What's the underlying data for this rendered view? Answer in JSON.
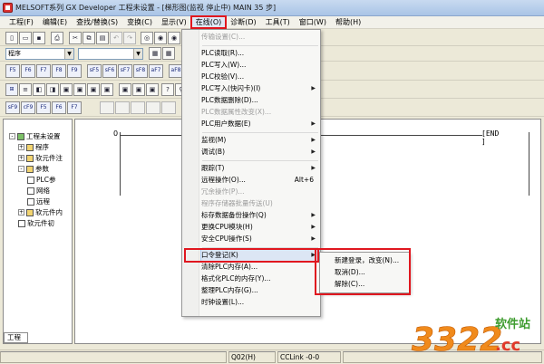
{
  "window": {
    "title": "MELSOFT系列 GX Developer 工程未设置 - [梯形图(监视 停止中)    MAIN    35 步]"
  },
  "menubar": {
    "items": [
      "工程(F)",
      "编辑(E)",
      "查找/替换(S)",
      "变换(C)",
      "显示(V)",
      "在线(O)",
      "诊断(D)",
      "工具(T)",
      "窗口(W)",
      "帮助(H)"
    ],
    "active_index": 5
  },
  "toolbar": {
    "combo1_value": "程序",
    "combo2_value": "",
    "ladder_buttons": [
      "F5",
      "F6",
      "F7",
      "F8",
      "F9",
      "sF5",
      "sF6",
      "sF7",
      "sF8",
      "aF7",
      "aF8",
      "F10",
      "aF9",
      "F11",
      "aF5"
    ],
    "row4_buttons": [
      "sF9",
      "cF9",
      "F5",
      "F6",
      "F7"
    ]
  },
  "tree": {
    "items": [
      {
        "label": "工程未设置",
        "level": 0,
        "icon": "project-icon",
        "expander": "-"
      },
      {
        "label": "程序",
        "level": 1,
        "icon": "folder-icon",
        "expander": "+"
      },
      {
        "label": "软元件注",
        "level": 1,
        "icon": "folder-icon",
        "expander": "+"
      },
      {
        "label": "参数",
        "level": 1,
        "icon": "folder-icon",
        "expander": "-"
      },
      {
        "label": "PLC参",
        "level": 2,
        "icon": "document-icon"
      },
      {
        "label": "网络",
        "level": 2,
        "icon": "document-icon"
      },
      {
        "label": "远程",
        "level": 2,
        "icon": "document-icon"
      },
      {
        "label": "软元件内",
        "level": 1,
        "icon": "folder-icon",
        "expander": "+"
      },
      {
        "label": "软元件初",
        "level": 1,
        "icon": "document-icon"
      }
    ],
    "tab_label": "工程"
  },
  "editor": {
    "step_number": "0",
    "end_label": "END"
  },
  "statusbar": {
    "cpu": "Q02(H)",
    "network": "CCLink -0-0"
  },
  "online_menu": {
    "items": [
      {
        "label": "传输设置(C)...",
        "disabled": true
      },
      {
        "sep": true
      },
      {
        "label": "PLC读取(R)..."
      },
      {
        "label": "PLC写入(W)..."
      },
      {
        "label": "PLC校验(V)..."
      },
      {
        "label": "PLC写入(快闪卡)(I)",
        "submenu": true
      },
      {
        "label": "PLC数据删除(D)..."
      },
      {
        "label": "PLC数据属性改变(X)...",
        "disabled": true
      },
      {
        "label": "PLC用户数据(E)",
        "submenu": true
      },
      {
        "sep": true
      },
      {
        "label": "监视(M)",
        "submenu": true
      },
      {
        "label": "调试(B)",
        "submenu": true
      },
      {
        "sep": true
      },
      {
        "label": "跟踪(T)",
        "submenu": true
      },
      {
        "label": "远程操作(O)...",
        "shortcut": "Alt+6"
      },
      {
        "label": "冗余操作(P)...",
        "disabled": true
      },
      {
        "label": "程序存储器批量传送(U)",
        "disabled": true
      },
      {
        "label": "标存数据备份操作(Q)",
        "submenu": true
      },
      {
        "label": "更换CPU模块(H)",
        "submenu": true
      },
      {
        "label": "安全CPU操作(S)",
        "submenu": true
      },
      {
        "sep": true
      },
      {
        "label": "口令登记(K)",
        "submenu": true,
        "highlighted": true
      },
      {
        "label": "清除PLC内存(A)..."
      },
      {
        "label": "格式化PLC的内存(Y)..."
      },
      {
        "label": "整理PLC内存(G)..."
      },
      {
        "label": "时钟设置(L)..."
      }
    ]
  },
  "password_submenu": {
    "items": [
      "新建登录，改变(N)...",
      "取消(D)...",
      "解除(C)..."
    ]
  },
  "watermark": {
    "number": "3322",
    "domain": ".cc",
    "site": "软件站"
  },
  "colors": {
    "highlight_red": "#e0171f",
    "menu_highlight": "#dce6f4",
    "watermark_orange": "#f08a1c"
  }
}
